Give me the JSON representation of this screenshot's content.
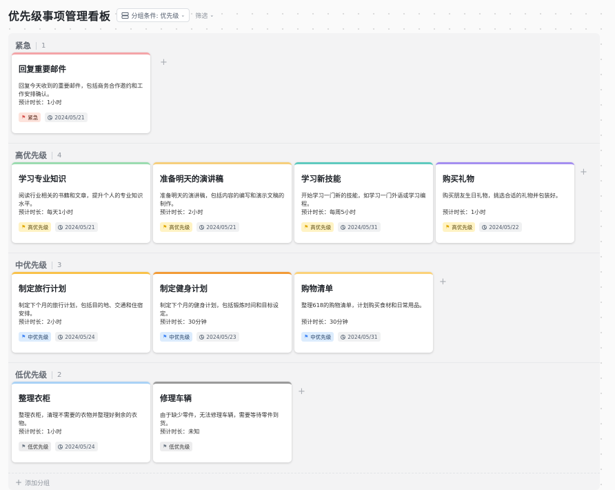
{
  "header": {
    "title": "优先级事项管理看板",
    "group_by_label": "分组条件: 优先级",
    "filter_label": "筛选"
  },
  "colors": {
    "urgent": "#f4a4a8",
    "high": "#9bdcb0",
    "high2": "#f6cf7c",
    "high3": "#5fcabf",
    "high4": "#a48ef0",
    "mid1": "#f9c24a",
    "mid2": "#f29b36",
    "mid3": "#fbd279",
    "low1": "#a9d2f6",
    "low2": "#9b9b9b"
  },
  "groups": [
    {
      "name": "紧急",
      "count": "1",
      "cards": [
        {
          "title": "回复重要邮件",
          "desc": "回复今天收到的重要邮件，包括商务合作邀约和工作安排确认。",
          "duration": "预计时长：1小时",
          "priority": "紧急",
          "date": "2024/05/21"
        }
      ]
    },
    {
      "name": "高优先级",
      "count": "4",
      "cards": [
        {
          "title": "学习专业知识",
          "desc": "阅读行业相关的书籍和文章，提升个人的专业知识水平。",
          "duration": "预计时长：每天1小时",
          "priority": "高优先级",
          "date": "2024/05/21"
        },
        {
          "title": "准备明天的演讲稿",
          "desc": "准备明天的演讲稿，包括内容的编写和演示文稿的制作。",
          "duration": "预计时长：2小时",
          "priority": "高优先级",
          "date": "2024/05/21"
        },
        {
          "title": "学习新技能",
          "desc": "开始学习一门新的技能，如学习一门外语或学习编程。",
          "duration": "预计时长：每周5小时",
          "priority": "高优先级",
          "date": "2024/05/31"
        },
        {
          "title": "购买礼物",
          "desc": "购买朋友生日礼物，挑选合适的礼物并包装好。",
          "duration": "预计时长：1小时",
          "priority": "高优先级",
          "date": "2024/05/22"
        }
      ]
    },
    {
      "name": "中优先级",
      "count": "3",
      "cards": [
        {
          "title": "制定旅行计划",
          "desc": "制定下个月的旅行计划，包括目的地、交通和住宿安排。",
          "duration": "预计时长：2小时",
          "priority": "中优先级",
          "date": "2024/05/24"
        },
        {
          "title": "制定健身计划",
          "desc": "制定下个月的健身计划，包括锻炼时间和目标设定。",
          "duration": "预计时长：30分钟",
          "priority": "中优先级",
          "date": "2024/05/23"
        },
        {
          "title": "购物清单",
          "desc": "整理618的购物清单，计划购买食材和日常用品。",
          "duration": "预计时长：30分钟",
          "priority": "中优先级",
          "date": "2024/05/31"
        }
      ]
    },
    {
      "name": "低优先级",
      "count": "2",
      "cards": [
        {
          "title": "整理衣柜",
          "desc": "整理衣柜，清理不需要的衣物并整理好剩余的衣物。",
          "duration": "预计时长：1小时",
          "priority": "低优先级",
          "date": "2024/05/24"
        },
        {
          "title": "修理车辆",
          "desc": "由于缺少零件，无法修理车辆，需要等待零件到货。",
          "duration": "预计时长：未知",
          "priority": "低优先级",
          "date": ""
        }
      ]
    }
  ],
  "add_group_label": "添加分组"
}
